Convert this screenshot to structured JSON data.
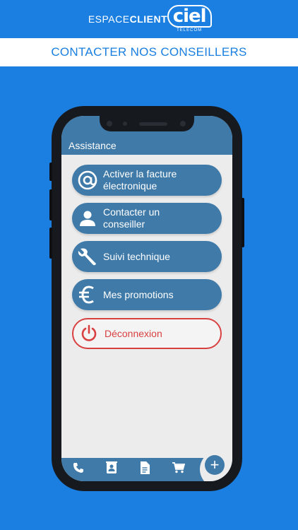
{
  "brand": {
    "espace": "ESPACE",
    "client": "CLIENT",
    "logo_mark": "ciel",
    "logo_sub": "TELECOM"
  },
  "banner": {
    "title": "CONTACTER NOS CONSEILLERS"
  },
  "app": {
    "title": "Assistance",
    "menu": [
      {
        "icon": "at-icon",
        "label": "Activer la facture\n électronique"
      },
      {
        "icon": "person-icon",
        "label": "Contacter un\nconseiller"
      },
      {
        "icon": "wrench-icon",
        "label": "Suivi technique"
      },
      {
        "icon": "euro-icon",
        "label": "Mes promotions"
      }
    ],
    "logout": {
      "icon": "power-icon",
      "label": "Déconnexion"
    },
    "tabs": [
      "phone-icon",
      "contacts-icon",
      "document-icon",
      "cart-icon"
    ],
    "fab": "+"
  },
  "colors": {
    "background": "#1a7fe0",
    "app_primary": "#3f7aa8",
    "logout": "#d94040"
  }
}
